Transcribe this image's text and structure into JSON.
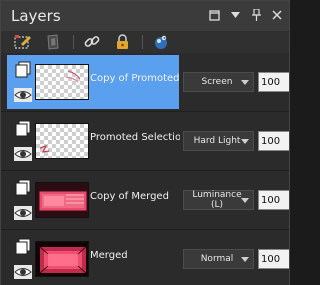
{
  "panel": {
    "title": "Layers",
    "window_controls": [
      "maximize-icon",
      "close-icon",
      "pin-icon",
      "close-icon"
    ]
  },
  "toolbar": {
    "tools": [
      "edit-selection-icon",
      "mask-icon",
      "link-icon",
      "lock-icon",
      "palette-icon"
    ]
  },
  "layers": [
    {
      "name": "Copy of Promoted Selection",
      "blend_mode": "Screen",
      "opacity": "100",
      "selected": true,
      "thumb": "checker-light-strokes",
      "type_icon": "raster-layer-icon"
    },
    {
      "name": "Promoted Selection",
      "blend_mode": "Hard Light",
      "opacity": "100",
      "selected": false,
      "thumb": "checker-red-mark",
      "type_icon": "raster-layer-icon"
    },
    {
      "name": "Copy of Merged",
      "blend_mode": "Luminance (L)",
      "opacity": "100",
      "selected": false,
      "thumb": "pink-red-frame",
      "type_icon": "raster-layer-icon"
    },
    {
      "name": "Merged",
      "blend_mode": "Normal",
      "opacity": "100",
      "selected": false,
      "thumb": "pink-red-frame-dark",
      "type_icon": "raster-layer-icon"
    }
  ],
  "colors": {
    "selected_row": "#5aa0ee",
    "panel_bg": "#2b2b2b",
    "thumb_pink": "#e94b6e",
    "thumb_dark": "#1a0a0d"
  }
}
